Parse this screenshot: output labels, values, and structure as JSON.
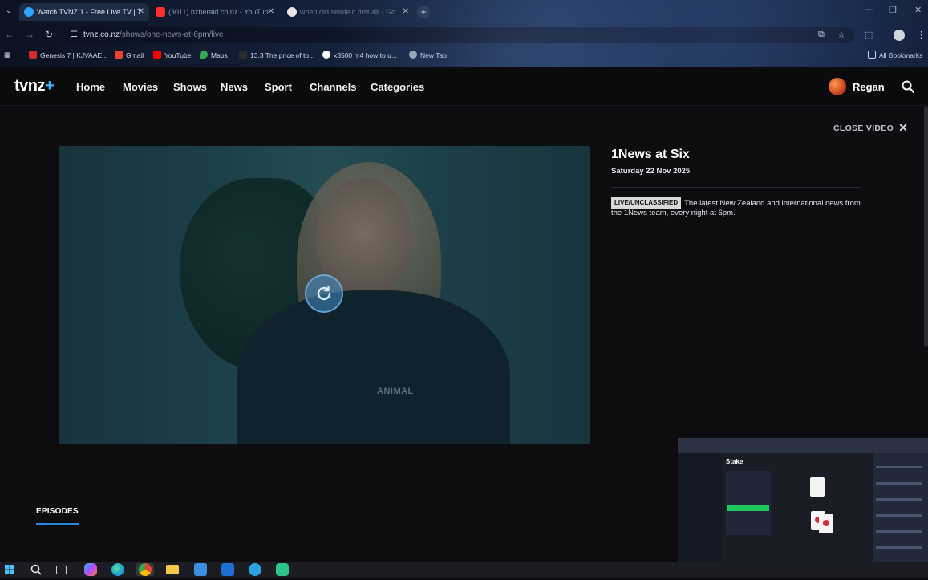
{
  "browser": {
    "tabs": [
      {
        "title": "Watch TVNZ 1 - Free Live TV | T",
        "active": true,
        "favicon_color": "#2fa6ff"
      },
      {
        "title": "(3011) nzherald.co.nz - YouTub",
        "active": false,
        "favicon_color": "#ff2e2e"
      },
      {
        "title": "when did seinfeld first air - Go",
        "active": false,
        "favicon_color": "#e6e6e6"
      }
    ],
    "new_tab": "+",
    "url_host": "tvnz.co.nz",
    "url_path": "/shows/one-news-at-6pm/live",
    "bookmarks": [
      {
        "label": "Genesis 7 | KJVAAE...",
        "color": "#d62a2a"
      },
      {
        "label": "Gmail",
        "color": "#ea4335"
      },
      {
        "label": "YouTube",
        "color": "#ff0000"
      },
      {
        "label": "Maps",
        "color": "#34a853"
      },
      {
        "label": "13.3 The price of to...",
        "color": "#2b2b2b"
      },
      {
        "label": "x3500 m4 how to u...",
        "color": "#ffffff"
      },
      {
        "label": "New Tab",
        "color": "#9aa3b5"
      }
    ],
    "all_bookmarks": "All Bookmarks"
  },
  "site": {
    "logo": "tvnz",
    "logo_plus": "+",
    "nav": [
      "Home",
      "Movies",
      "Shows",
      "News",
      "Sport",
      "Channels",
      "Categories"
    ],
    "user_name": "Regan"
  },
  "video": {
    "close_label": "CLOSE VIDEO",
    "close_icon": "✕",
    "shirt_logo": "ANIMAL"
  },
  "program": {
    "title": "1News at Six",
    "date": "Saturday 22 Nov 2025",
    "badge": "LIVE/UNCLASSIFIED",
    "description": "The latest New Zealand and international news from the 1News team, every night at 6pm."
  },
  "episodes_label": "EPISODES",
  "pip": {
    "logo": "Stake"
  },
  "taskbar_icons": [
    "windows-start",
    "search",
    "task-view",
    "copilot",
    "edge",
    "chrome",
    "file-explorer",
    "store",
    "outlook",
    "telegram",
    "app"
  ]
}
